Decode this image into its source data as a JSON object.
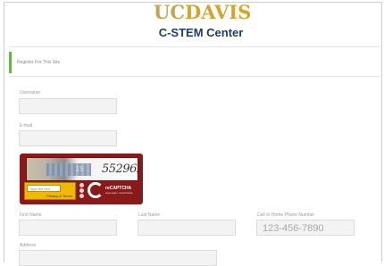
{
  "header": {
    "logo_uc": "UC",
    "logo_davis": "DAVIS",
    "subtitle": "C-STEM Center"
  },
  "page": {
    "title": "Register For This Site"
  },
  "form": {
    "username_label": "Username",
    "email_label": "E-mail",
    "first_name_label": "First Name",
    "last_name_label": "Last Name",
    "phone_label": "Cell or Home Phone Number",
    "phone_placeholder": "123-456-7890",
    "address_label": "Address"
  },
  "captcha": {
    "challenge_text": "5529629",
    "challenge_small": "15",
    "input_placeholder": "Type the text",
    "privacy_label": "Privacy & Terms",
    "brand": "reCAPTCHA",
    "brand_tagline": "stop spam. read books."
  },
  "colors": {
    "accent_green": "#6ab24a",
    "captcha_red": "#8a1a1a",
    "captcha_yellow": "#f2b800",
    "brand_gold": "#d4a52d",
    "brand_blue": "#1e3a6e"
  }
}
